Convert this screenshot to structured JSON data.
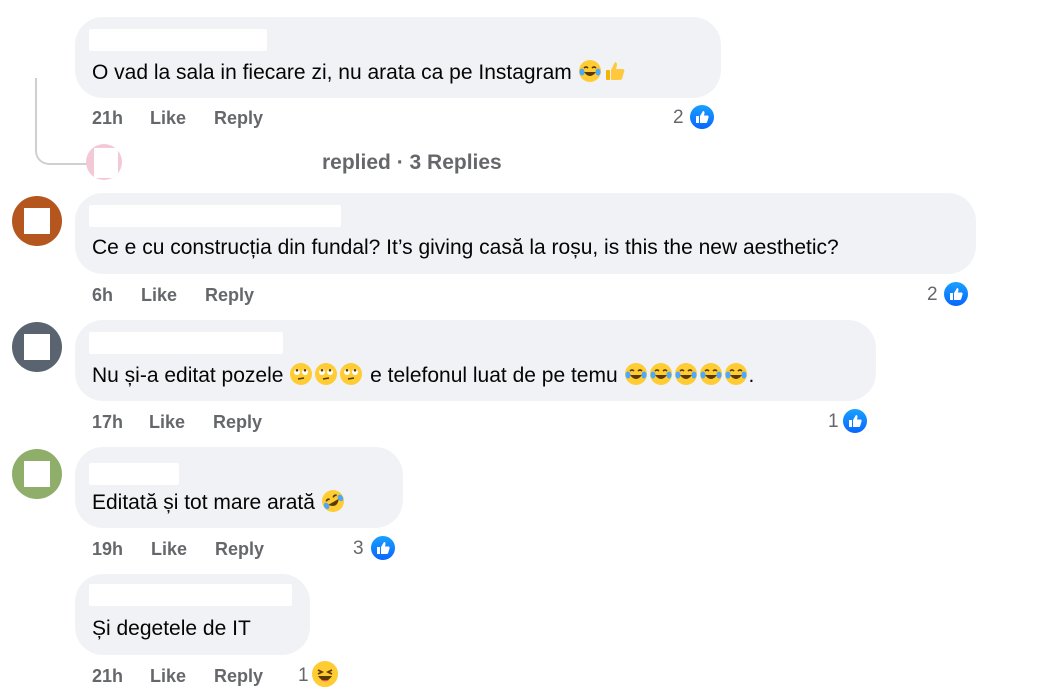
{
  "comments": [
    {
      "text": "O vad la sala in fiecare zi, nu arata ca pe Instagram",
      "time": "21h",
      "like_label": "Like",
      "reply_label": "Reply",
      "reaction_count": "2",
      "emoji": [
        "laughing-tears-emoji",
        "thumbs-up-emoji"
      ]
    },
    {
      "text": "Ce e cu construcția din fundal? It’s giving casă la roșu, is this the new aesthetic?",
      "time": "6h",
      "like_label": "Like",
      "reply_label": "Reply",
      "reaction_count": "2"
    },
    {
      "text_before": "Nu și-a editat pozele",
      "text_middle": "e telefonul luat de pe temu",
      "text_end": ".",
      "time": "17h",
      "like_label": "Like",
      "reply_label": "Reply",
      "reaction_count": "1",
      "emoji": [
        "rolling-eyes-emoji",
        "laughing-tears-emoji"
      ]
    },
    {
      "text": "Editată și tot mare arată",
      "time": "19h",
      "like_label": "Like",
      "reply_label": "Reply",
      "reaction_count": "3",
      "emoji": [
        "rolling-laughing-emoji"
      ]
    },
    {
      "text": "Și degetele de IT",
      "time": "21h",
      "like_label": "Like",
      "reply_label": "Reply",
      "reaction_count": "1",
      "emoji": [
        "haha-reaction-emoji"
      ]
    }
  ],
  "replies_summary": {
    "text": "replied · 3 Replies"
  },
  "colors": {
    "bubble": "#f0f2f5",
    "meta_text": "#65676b",
    "like_blue": "#0866ff"
  }
}
